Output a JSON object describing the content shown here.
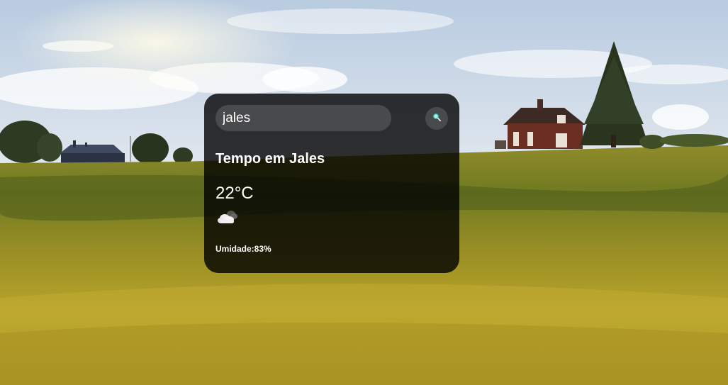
{
  "search": {
    "value": "jales",
    "icon": "search-icon"
  },
  "weather": {
    "title": "Tempo em Jales",
    "temperature": "22°C",
    "icon": "partly-cloudy-icon",
    "humidity": "Umidade:83%"
  },
  "colors": {
    "card_background": "rgba(0,0,0,0.8)",
    "input_background": "#4a4a4a",
    "text": "#ffffff"
  }
}
